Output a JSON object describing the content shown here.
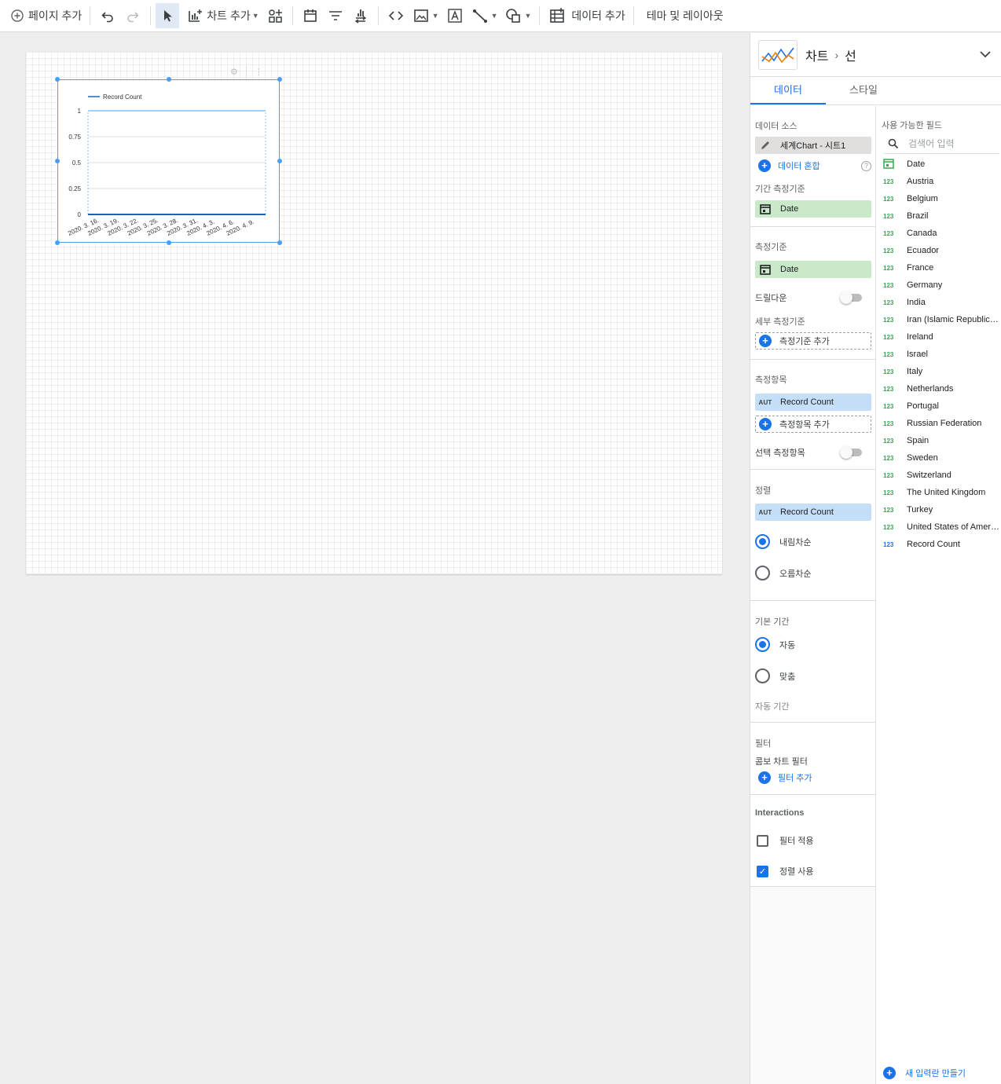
{
  "toolbar": {
    "add_page": "페이지 추가",
    "add_chart": "차트 추가",
    "add_data": "데이터 추가",
    "theme_layout": "테마 및 레이아웃"
  },
  "chart": {
    "legend": "Record Count",
    "y_ticks": [
      "1",
      "0.75",
      "0.5",
      "0.25",
      "0"
    ],
    "x_ticks": [
      "2020. 3. 16.",
      "2020. 3. 19.",
      "2020. 3. 22.",
      "2020. 3. 25.",
      "2020. 3. 28.",
      "2020. 3. 31.",
      "2020. 4. 3.",
      "2020. 4. 6.",
      "2020. 4. 9."
    ],
    "line_color": "#1565c0"
  },
  "chart_data": {
    "type": "line",
    "title": "",
    "xlabel": "",
    "ylabel": "",
    "categories": [
      "2020. 3. 16.",
      "2020. 3. 19.",
      "2020. 3. 22.",
      "2020. 3. 25.",
      "2020. 3. 28.",
      "2020. 3. 31.",
      "2020. 4. 3.",
      "2020. 4. 6.",
      "2020. 4. 9."
    ],
    "series": [
      {
        "name": "Record Count",
        "values": [
          0,
          0,
          0,
          0,
          0,
          0,
          0,
          0,
          0
        ]
      }
    ],
    "ylim": [
      0,
      1
    ],
    "grid": true,
    "legend_position": "top-left"
  },
  "panel": {
    "crumb_root": "차트",
    "crumb_leaf": "선",
    "tabs": [
      "데이터",
      "스타일"
    ],
    "data_source_title": "데이터 소스",
    "data_source_name": "세계Chart - 시트1",
    "blend_label": "데이터 혼합",
    "date_range_dim_title": "기간 측정기준",
    "date_range_dim": "Date",
    "dimension_title": "측정기준",
    "dimension": "Date",
    "drilldown": "드릴다운",
    "breakdown_title": "세부 측정기준",
    "add_dimension": "측정기준 추가",
    "metric_title": "측정항목",
    "metric": "Record Count",
    "add_metric": "측정항목 추가",
    "optional_metrics": "선택 측정항목",
    "sort_title": "정렬",
    "sort_field": "Record Count",
    "sort_desc": "내림차순",
    "sort_asc": "오름차순",
    "default_range_title": "기본 기간",
    "range_auto": "자동",
    "range_custom": "맞춤",
    "auto_range": "자동 기간",
    "filter_title": "필터",
    "combo_filter": "콤보 차트 필터",
    "add_filter": "필터 추가",
    "interactions_title": "Interactions",
    "apply_filter": "필터 적용",
    "enable_sort": "정렬 사용",
    "aut": "AUT"
  },
  "fields": {
    "title": "사용 가능한 필드",
    "search_placeholder": "검색어 입력",
    "num_icon": "123",
    "items": [
      "Date",
      "Austria",
      "Belgium",
      "Brazil",
      "Canada",
      "Ecuador",
      "France",
      "Germany",
      "India",
      "Iran (Islamic Republic of)",
      "Ireland",
      "Israel",
      "Italy",
      "Netherlands",
      "Portugal",
      "Russian Federation",
      "Spain",
      "Sweden",
      "Switzerland",
      "The United Kingdom",
      "Turkey",
      "United States of America",
      "Record Count"
    ],
    "create_new": "새 입력란 만들기"
  }
}
